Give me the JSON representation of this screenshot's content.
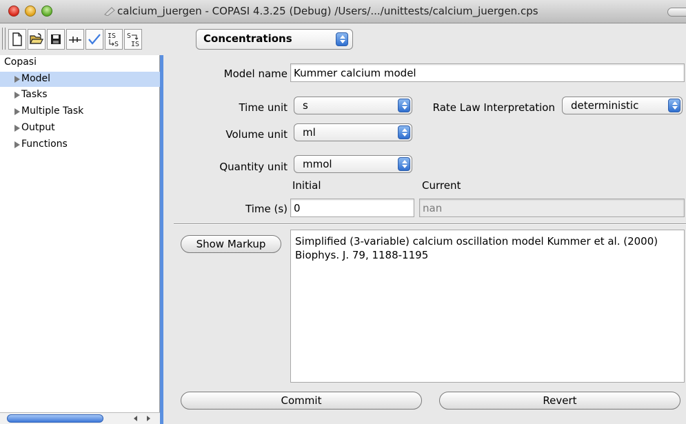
{
  "window": {
    "title": "calcium_juergen - COPASI 4.3.25 (Debug) /Users/.../unittests/calcium_juergen.cps"
  },
  "toolbar": {
    "buttons": [
      "new-document-icon",
      "open-folder-icon",
      "save-disk-icon",
      "sliders-icon",
      "check-icon",
      "is-to-s-icon",
      "s-to-is-icon"
    ],
    "is_label": "IS",
    "s_label": "S",
    "mode_select": "Concentrations"
  },
  "tree": {
    "root": "Copasi",
    "items": [
      {
        "label": "Model",
        "selected": true
      },
      {
        "label": "Tasks"
      },
      {
        "label": "Multiple Task"
      },
      {
        "label": "Output"
      },
      {
        "label": "Functions"
      }
    ]
  },
  "form": {
    "model_name_label": "Model name",
    "model_name_value": "Kummer calcium model",
    "time_unit_label": "Time unit",
    "time_unit_value": "s",
    "rate_law_label": "Rate Law Interpretation",
    "rate_law_value": "deterministic",
    "volume_unit_label": "Volume unit",
    "volume_unit_value": "ml",
    "quantity_unit_label": "Quantity unit",
    "quantity_unit_value": "mmol",
    "initial_header": "Initial",
    "current_header": "Current",
    "time_label": "Time (s)",
    "time_initial": "0",
    "time_current": "nan",
    "show_markup": "Show Markup",
    "notes": "Simplified (3-variable) calcium oscillation model Kummer et al. (2000) Biophys. J. 79, 1188-1195",
    "commit": "Commit",
    "revert": "Revert"
  },
  "colors": {
    "selection": "#c4d9f7",
    "accent": "#3f79d8"
  }
}
